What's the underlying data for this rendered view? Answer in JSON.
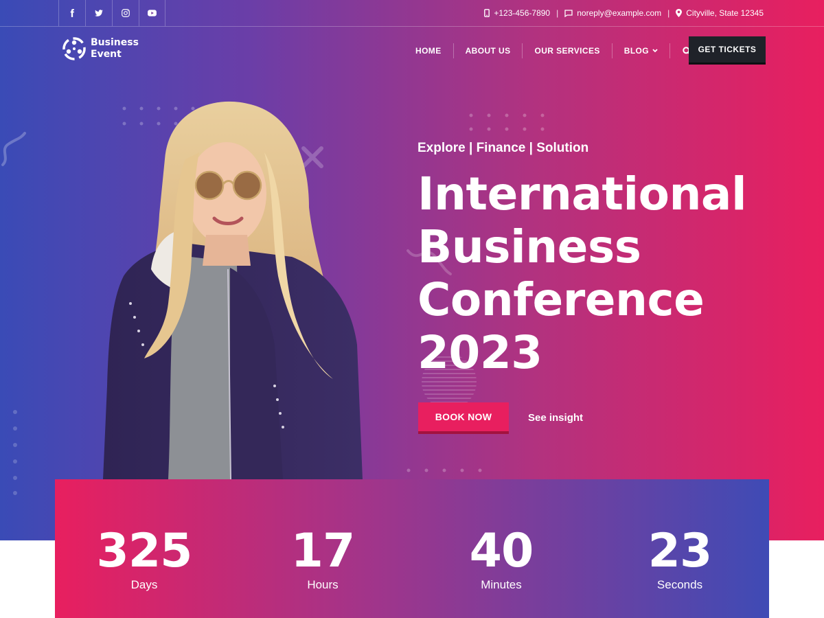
{
  "topbar": {
    "social": [
      {
        "icon": "facebook-icon"
      },
      {
        "icon": "twitter-icon"
      },
      {
        "icon": "instagram-icon"
      },
      {
        "icon": "youtube-icon"
      }
    ],
    "phone": "+123-456-7890",
    "email": "noreply@example.com",
    "address": "Cityville, State 12345",
    "separator": "|"
  },
  "nav": {
    "logo_line1": "Business",
    "logo_line2": "Event",
    "menu": [
      "HOME",
      "ABOUT US",
      "OUR SERVICES",
      "BLOG"
    ],
    "cta": "GET TICKETS"
  },
  "hero": {
    "tagline": "Explore | Finance | Solution",
    "title_lines": [
      "International",
      "Business",
      "Conference",
      "2023"
    ],
    "primary_button": "BOOK NOW",
    "secondary_link": "See insight"
  },
  "countdown": [
    {
      "value": "325",
      "label": "Days"
    },
    {
      "value": "17",
      "label": "Hours"
    },
    {
      "value": "40",
      "label": "Minutes"
    },
    {
      "value": "23",
      "label": "Seconds"
    }
  ],
  "colors": {
    "accent": "#e81f5f",
    "gradient_start": "#3a4bb6",
    "gradient_end": "#e81f5f",
    "button_dark": "#1f2229"
  }
}
